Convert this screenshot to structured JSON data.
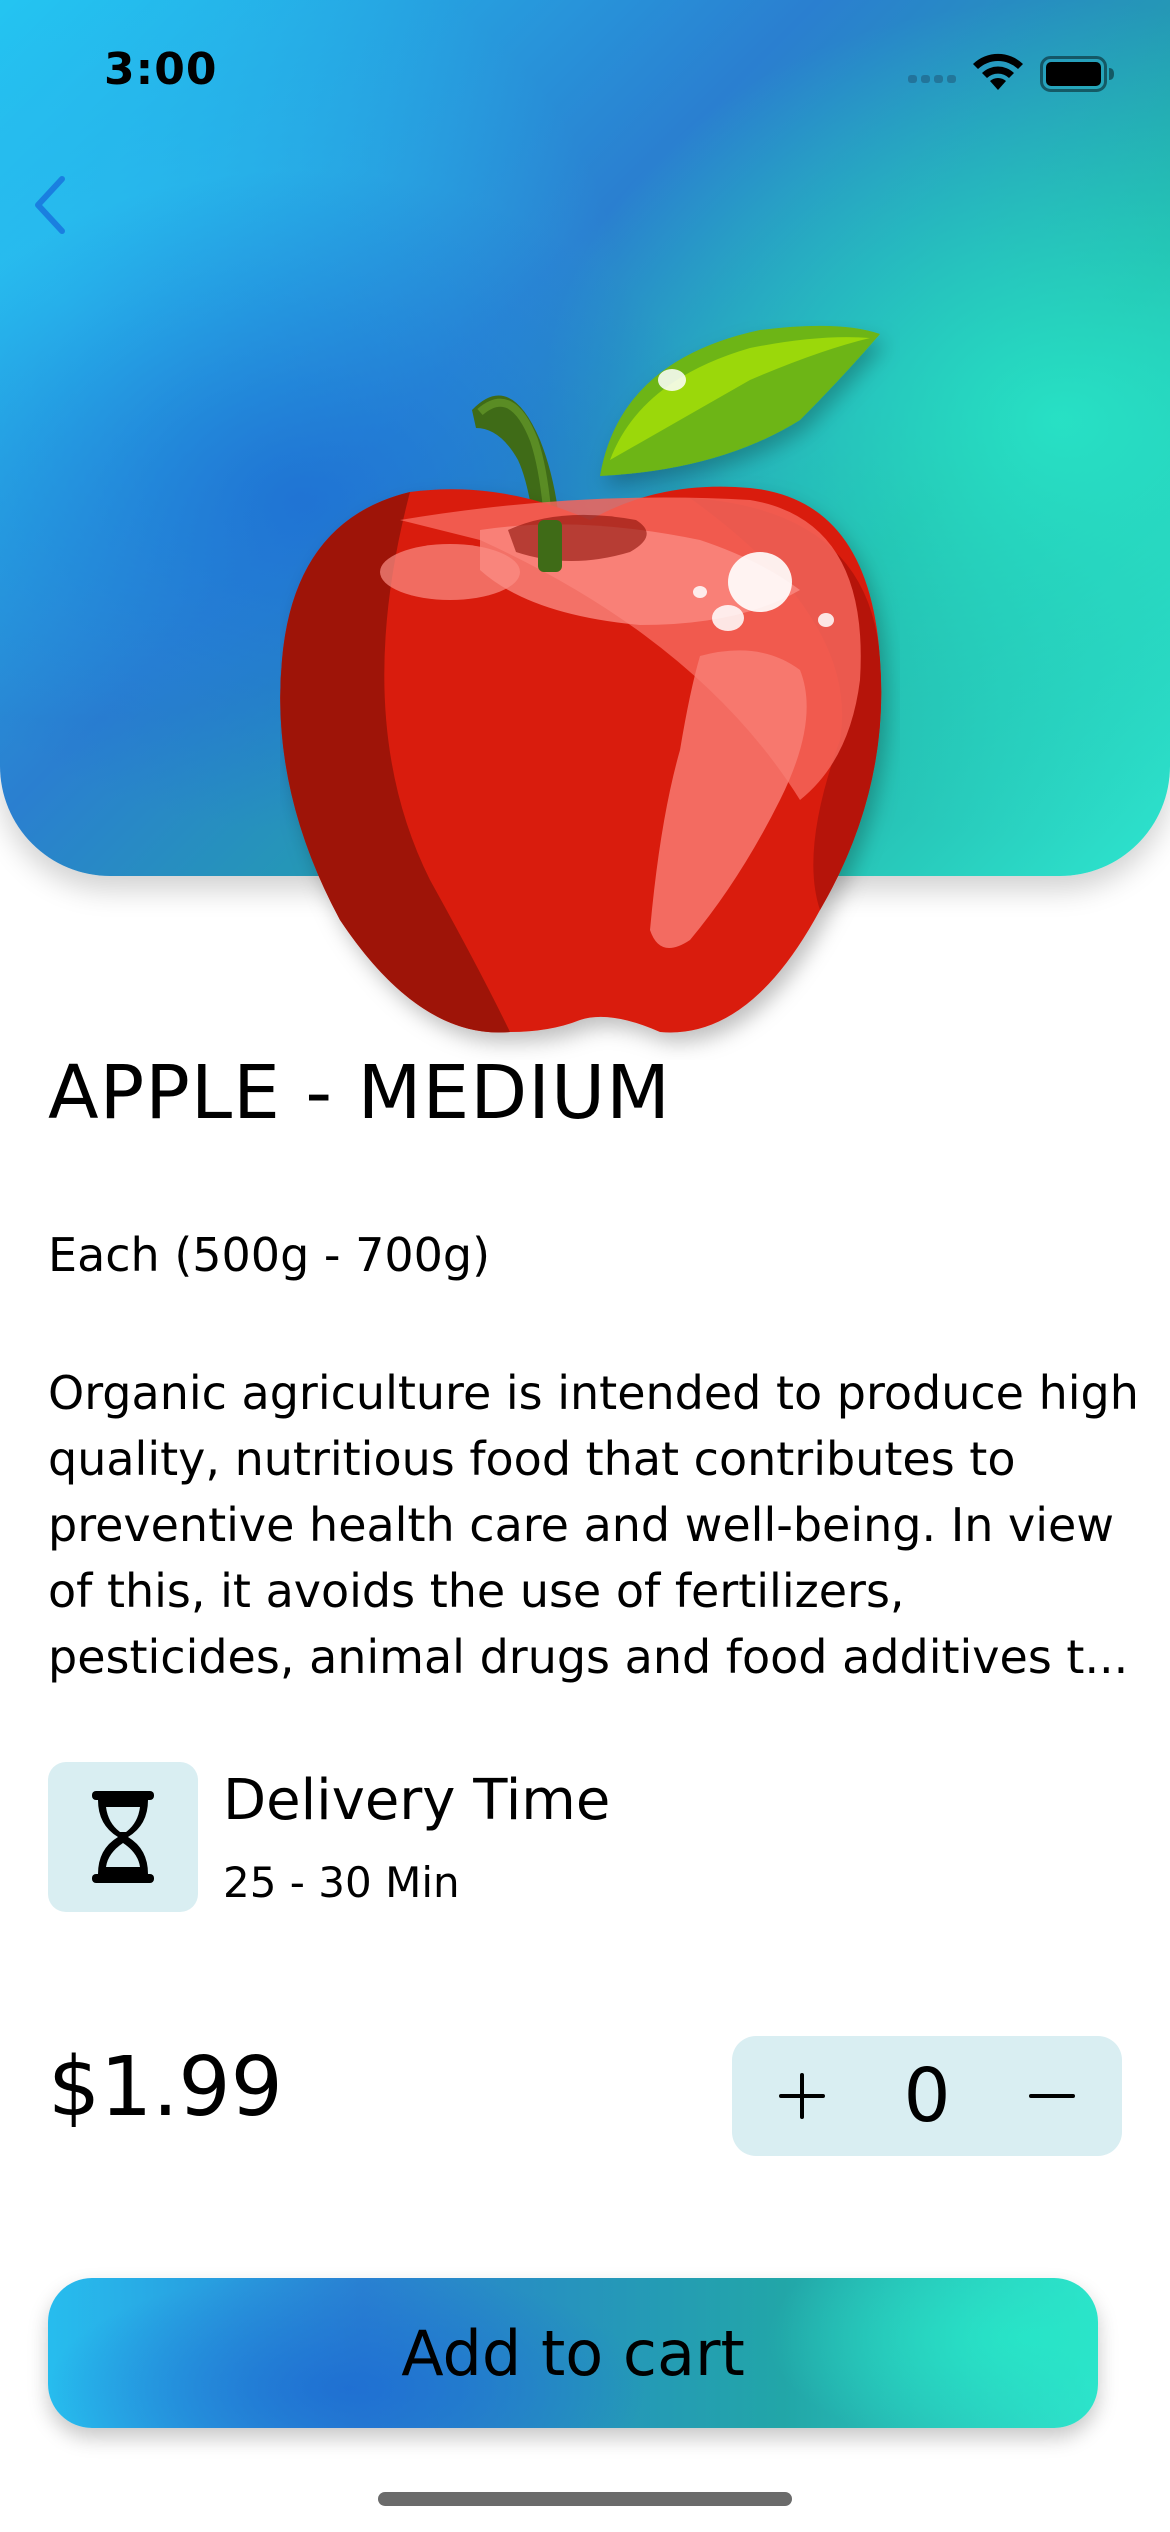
{
  "status_bar": {
    "time": "3:00",
    "signal_icon": "cellular-signal-icon",
    "wifi_icon": "wifi-icon",
    "battery_icon": "battery-icon"
  },
  "nav": {
    "back_icon": "chevron-left-icon",
    "accent_color": "#1a7fe0"
  },
  "hero": {
    "image_icon": "red-apple-image",
    "gradient_colors": [
      "#22c7f2",
      "#2a7fd0",
      "#21a9a4",
      "#2ee6cf"
    ]
  },
  "product": {
    "title": "APPLE - MEDIUM",
    "unit": "Each (500g - 700g)",
    "description_lines": [
      "Organic agriculture is intended to produce high",
      "quality, nutritious food that contributes to",
      "preventive health care and well-being. In view",
      "of this, it avoids the use of fertilizers,",
      "pesticides, animal drugs and food additives t..."
    ]
  },
  "delivery": {
    "icon": "hourglass-icon",
    "title": "Delivery Time",
    "value": "25 - 30 Min"
  },
  "purchase": {
    "price": "$1.99",
    "quantity": "0",
    "plus_label": "+",
    "minus_label": "−",
    "add_to_cart_label": "Add to cart"
  }
}
